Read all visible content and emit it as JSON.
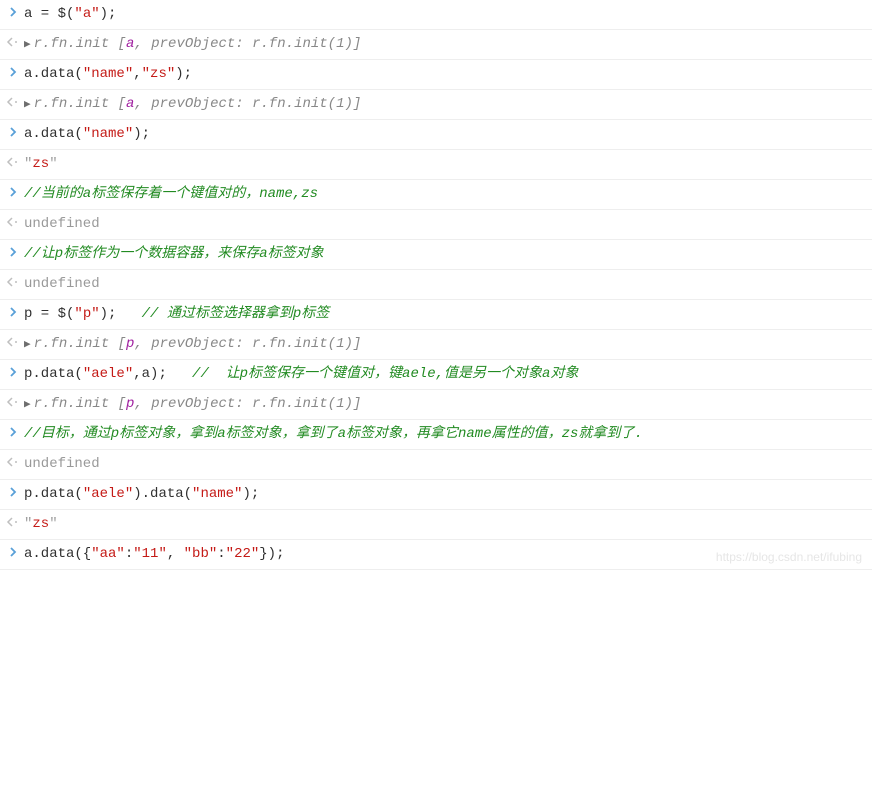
{
  "rows": [
    {
      "type": "input",
      "segments": [
        {
          "text": "a = $(",
          "cls": "c-black"
        },
        {
          "text": "\"a\"",
          "cls": "c-string"
        },
        {
          "text": ");",
          "cls": "c-black"
        }
      ]
    },
    {
      "type": "output",
      "expand": true,
      "segments": [
        {
          "text": "r.fn.init [",
          "cls": "c-darkgray"
        },
        {
          "text": "a",
          "cls": "c-purple"
        },
        {
          "text": ", prevObject: r.fn.init(1)",
          "cls": "c-darkgray"
        },
        {
          "text": "]",
          "cls": "c-darkgray"
        }
      ]
    },
    {
      "type": "input",
      "segments": [
        {
          "text": "a.data(",
          "cls": "c-black"
        },
        {
          "text": "\"name\"",
          "cls": "c-string"
        },
        {
          "text": ",",
          "cls": "c-black"
        },
        {
          "text": "\"zs\"",
          "cls": "c-string"
        },
        {
          "text": ");",
          "cls": "c-black"
        }
      ]
    },
    {
      "type": "output",
      "expand": true,
      "segments": [
        {
          "text": "r.fn.init [",
          "cls": "c-darkgray"
        },
        {
          "text": "a",
          "cls": "c-purple"
        },
        {
          "text": ", prevObject: r.fn.init(1)",
          "cls": "c-darkgray"
        },
        {
          "text": "]",
          "cls": "c-darkgray"
        }
      ]
    },
    {
      "type": "input",
      "segments": [
        {
          "text": "a.data(",
          "cls": "c-black"
        },
        {
          "text": "\"name\"",
          "cls": "c-string"
        },
        {
          "text": ");",
          "cls": "c-black"
        }
      ]
    },
    {
      "type": "output",
      "segments": [
        {
          "text": "\"",
          "cls": "c-gray"
        },
        {
          "text": "zs",
          "cls": "c-string"
        },
        {
          "text": "\"",
          "cls": "c-gray"
        }
      ]
    },
    {
      "type": "input",
      "segments": [
        {
          "text": "//当前的a标签保存着一个键值对的，name,zs",
          "cls": "c-comment"
        }
      ]
    },
    {
      "type": "output",
      "segments": [
        {
          "text": "undefined",
          "cls": "c-undefined"
        }
      ]
    },
    {
      "type": "input",
      "segments": [
        {
          "text": "//让p标签作为一个数据容器，来保存a标签对象",
          "cls": "c-comment"
        }
      ]
    },
    {
      "type": "output",
      "segments": [
        {
          "text": "undefined",
          "cls": "c-undefined"
        }
      ]
    },
    {
      "type": "input",
      "segments": [
        {
          "text": "p = $(",
          "cls": "c-black"
        },
        {
          "text": "\"p\"",
          "cls": "c-string"
        },
        {
          "text": ");   ",
          "cls": "c-black"
        },
        {
          "text": "// 通过标签选择器拿到p标签",
          "cls": "c-comment"
        }
      ]
    },
    {
      "type": "output",
      "expand": true,
      "segments": [
        {
          "text": "r.fn.init [",
          "cls": "c-darkgray"
        },
        {
          "text": "p",
          "cls": "c-purple"
        },
        {
          "text": ", prevObject: r.fn.init(1)",
          "cls": "c-darkgray"
        },
        {
          "text": "]",
          "cls": "c-darkgray"
        }
      ]
    },
    {
      "type": "input",
      "segments": [
        {
          "text": "p.data(",
          "cls": "c-black"
        },
        {
          "text": "\"aele\"",
          "cls": "c-string"
        },
        {
          "text": ",a);   ",
          "cls": "c-black"
        },
        {
          "text": "//  让p标签保存一个键值对，键aele,值是另一个对象a对象",
          "cls": "c-comment"
        }
      ]
    },
    {
      "type": "output",
      "expand": true,
      "segments": [
        {
          "text": "r.fn.init [",
          "cls": "c-darkgray"
        },
        {
          "text": "p",
          "cls": "c-purple"
        },
        {
          "text": ", prevObject: r.fn.init(1)",
          "cls": "c-darkgray"
        },
        {
          "text": "]",
          "cls": "c-darkgray"
        }
      ]
    },
    {
      "type": "input",
      "segments": [
        {
          "text": "//目标，通过p标签对象，拿到a标签对象，拿到了a标签对象，再拿它name属性的值，zs就拿到了.",
          "cls": "c-comment"
        }
      ]
    },
    {
      "type": "output",
      "segments": [
        {
          "text": "undefined",
          "cls": "c-undefined"
        }
      ]
    },
    {
      "type": "input",
      "segments": [
        {
          "text": "p.data(",
          "cls": "c-black"
        },
        {
          "text": "\"aele\"",
          "cls": "c-string"
        },
        {
          "text": ").data(",
          "cls": "c-black"
        },
        {
          "text": "\"name\"",
          "cls": "c-string"
        },
        {
          "text": ");",
          "cls": "c-black"
        }
      ]
    },
    {
      "type": "output",
      "segments": [
        {
          "text": "\"",
          "cls": "c-gray"
        },
        {
          "text": "zs",
          "cls": "c-string"
        },
        {
          "text": "\"",
          "cls": "c-gray"
        }
      ]
    },
    {
      "type": "input",
      "segments": [
        {
          "text": "a.data({",
          "cls": "c-black"
        },
        {
          "text": "\"aa\"",
          "cls": "c-string"
        },
        {
          "text": ":",
          "cls": "c-black"
        },
        {
          "text": "\"11\"",
          "cls": "c-string"
        },
        {
          "text": ", ",
          "cls": "c-black"
        },
        {
          "text": "\"bb\"",
          "cls": "c-string"
        },
        {
          "text": ":",
          "cls": "c-black"
        },
        {
          "text": "\"22\"",
          "cls": "c-string"
        },
        {
          "text": "});",
          "cls": "c-black"
        }
      ]
    }
  ],
  "markers": {
    "input": "❯",
    "output": "❮⸱",
    "expand_icon": "▶"
  },
  "watermark": "https://blog.csdn.net/ifubing"
}
